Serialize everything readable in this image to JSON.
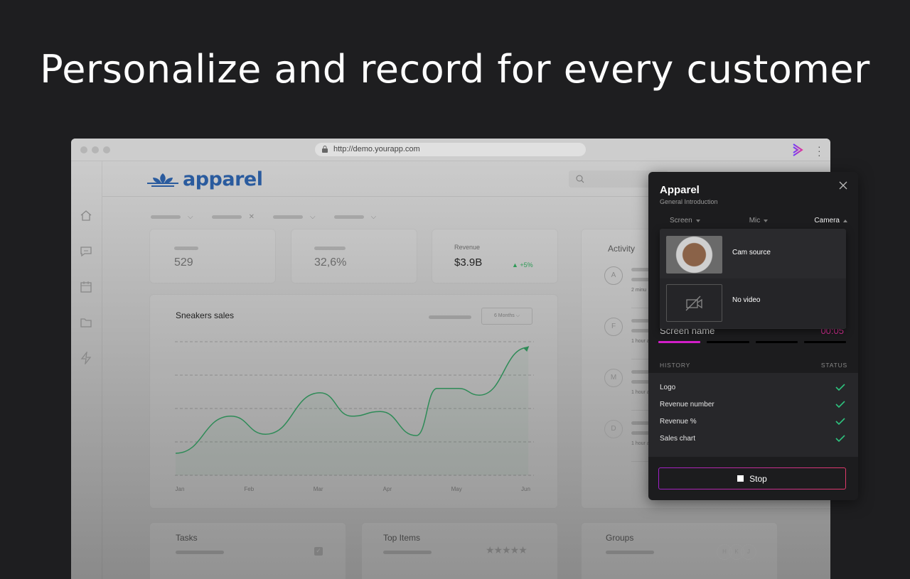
{
  "headline": "Personalize and record for every customer",
  "browser": {
    "url": "http://demo.yourapp.com"
  },
  "app": {
    "logo_text": "apparel",
    "brand_color": "#2a5b9e",
    "sidebar_icons": [
      "home-icon",
      "chat-icon",
      "calendar-icon",
      "folder-icon",
      "lightning-icon"
    ],
    "stats": [
      {
        "value": "529"
      },
      {
        "value": "32,6%"
      },
      {
        "label": "Revenue",
        "value": "$3.9B",
        "change": "+5%"
      }
    ],
    "chart": {
      "title": "Sneakers sales",
      "range_select": "6 Months"
    },
    "activity": {
      "title": "Activity",
      "items": [
        {
          "initial": "A",
          "time": "2 minu"
        },
        {
          "initial": "F",
          "time": "1 hour a"
        },
        {
          "initial": "M",
          "time": "1 hour a"
        },
        {
          "initial": "D",
          "time": "1 hour a"
        }
      ]
    },
    "bottom_cards": [
      {
        "title": "Tasks"
      },
      {
        "title": "Top Items"
      },
      {
        "title": "Groups",
        "avatars": [
          "H",
          "K",
          "J"
        ]
      }
    ]
  },
  "chart_data": {
    "type": "line",
    "title": "Sneakers sales",
    "categories": [
      "Jan",
      "Feb",
      "Mar",
      "Apr",
      "May",
      "Jun"
    ],
    "x": [
      0,
      0.8,
      1.3,
      2.09,
      2.55,
      2.96,
      3.48,
      3.78,
      4.09,
      4.39,
      5.1
    ],
    "values": [
      0.66,
      1.77,
      1.23,
      2.47,
      1.77,
      1.91,
      1.19,
      2.6,
      2.6,
      2.4,
      3.83
    ],
    "ylim": [
      0,
      4
    ],
    "grid": true,
    "line_color": "#2e8b57"
  },
  "recorder": {
    "title": "Apparel",
    "subtitle": "General Introduction",
    "sources": [
      {
        "label": "Screen",
        "open": false
      },
      {
        "label": "Mic",
        "open": false
      },
      {
        "label": "Camera",
        "open": true
      }
    ],
    "camera_options": [
      {
        "label": "Cam source"
      },
      {
        "label": "No video"
      }
    ],
    "screen_name": "Screen name",
    "timer": "00:05",
    "progress_segments": 4,
    "progress_active": 1,
    "history_header": "HISTORY",
    "status_header": "STATUS",
    "history": [
      {
        "label": "Logo",
        "status": "done"
      },
      {
        "label": "Revenue number",
        "status": "done"
      },
      {
        "label": "Revenue %",
        "status": "done"
      },
      {
        "label": "Sales chart",
        "status": "done"
      }
    ],
    "stop_label": "Stop",
    "accent": "#e0339a",
    "check_color": "#2ec27e"
  }
}
